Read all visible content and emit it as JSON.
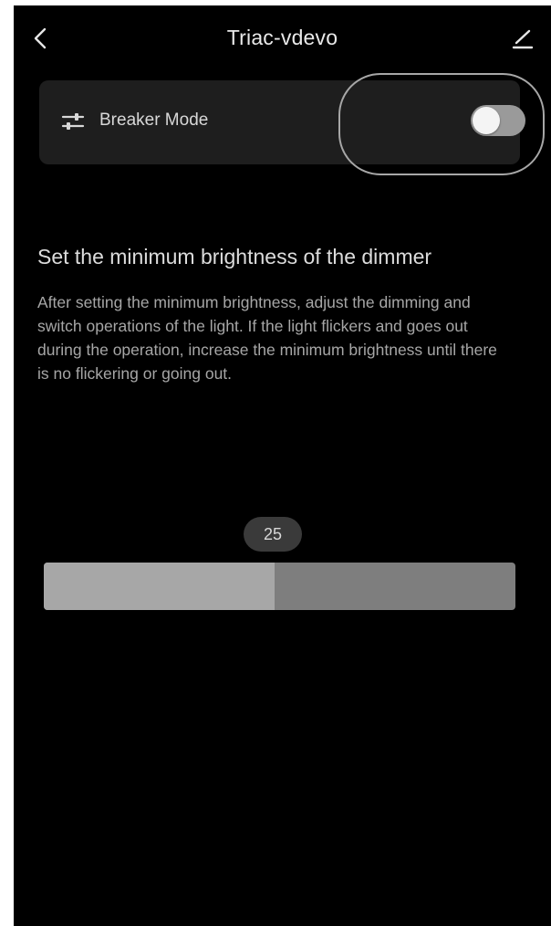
{
  "header": {
    "title": "Triac-vdevo",
    "back_icon": "chevron-left-icon",
    "edit_icon": "pencil-icon"
  },
  "breaker_mode": {
    "icon": "sliders-icon",
    "label": "Breaker Mode",
    "enabled": false
  },
  "main": {
    "heading": "Set the minimum brightness of the dimmer",
    "description": "After setting the minimum brightness, adjust the dimming and switch operations of the light. If the light flickers and goes out during the operation, increase the minimum brightness until there is no flickering or going out."
  },
  "slider": {
    "value": "25",
    "fill_fraction": 0.49
  },
  "colors": {
    "background": "#000000",
    "card": "#1e1e1e",
    "toggle_track": "#9a9a9a",
    "slider_fill": "#a7a7a7",
    "slider_track": "#7e7e7e"
  }
}
